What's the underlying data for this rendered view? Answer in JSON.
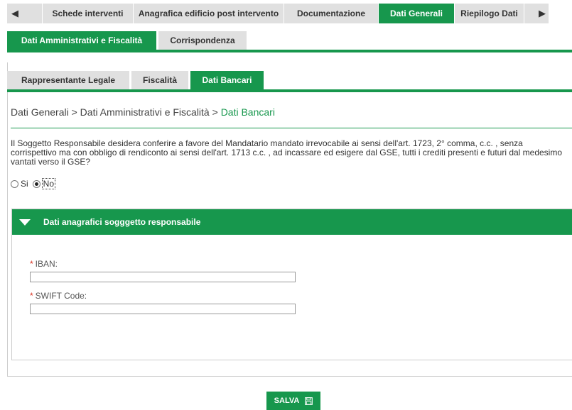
{
  "top_tabs": {
    "items": [
      {
        "label": "Schede interventi"
      },
      {
        "label": "Anagrafica edificio post intervento"
      },
      {
        "label": "Documentazione"
      },
      {
        "label": "Dati Generali",
        "active": true
      },
      {
        "label": "Riepilogo Dati"
      }
    ],
    "prev_icon": "◀",
    "next_icon": "▶"
  },
  "sub_tabs": [
    {
      "label": "Dati Amministrativi e Fiscalità",
      "active": true
    },
    {
      "label": "Corrispondenza"
    }
  ],
  "third_tabs": [
    {
      "label": "Rappresentante Legale"
    },
    {
      "label": "Fiscalità"
    },
    {
      "label": "Dati Bancari",
      "active": true
    }
  ],
  "breadcrumb": {
    "part1": "Dati Generali",
    "sep": ">",
    "part2": "Dati Amministrativi e Fiscalità",
    "current": "Dati Bancari"
  },
  "question": "Il Soggetto Responsabile desidera conferire a favore del Mandatario mandato irrevocabile ai sensi dell'art. 1723, 2° comma, c.c. , senza corrispettivo ma con obbligo di rendiconto ai sensi dell'art. 1713 c.c. , ad incassare ed esigere dal GSE, tutti i crediti presenti e futuri dal medesimo vantati verso il GSE?",
  "radio": {
    "yes_label": "Si",
    "no_label": "No",
    "selected": "No"
  },
  "panel": {
    "title": "Dati anagrafici sogggetto responsabile",
    "required_mark": "*",
    "iban_label": "IBAN:",
    "iban_value": "",
    "swift_label": "SWIFT Code:",
    "swift_value": ""
  },
  "save_button": {
    "label": "SALVA",
    "icon": "floppy-disk-icon"
  },
  "colors": {
    "accent": "#17974d",
    "tab_inactive": "#e0e0e0",
    "required": "#d9301f"
  }
}
